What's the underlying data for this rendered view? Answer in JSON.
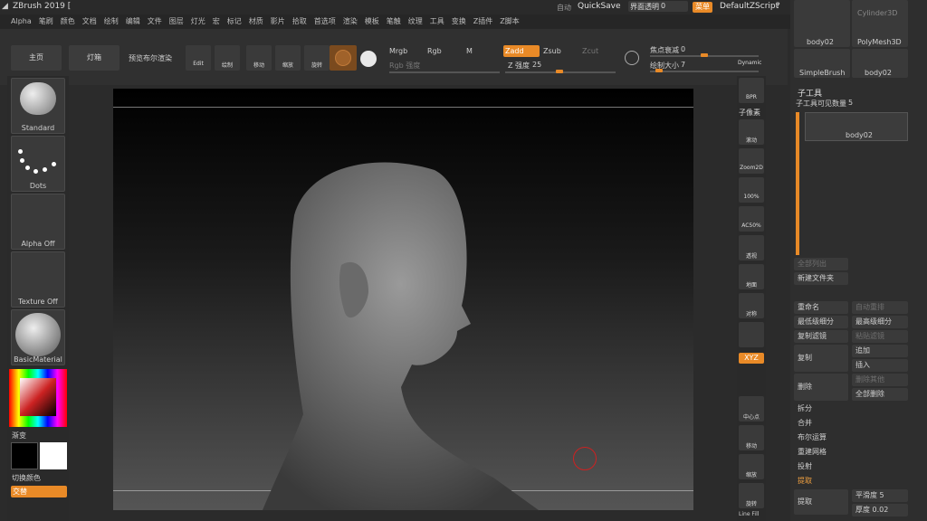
{
  "titlebar": {
    "app_title": "ZBrush 2019 [",
    "auto": "自动",
    "quicksave": "QuickSave",
    "interface_transparency": "界面透明",
    "interface_transparency_value": "0",
    "menu_button": "菜单",
    "default_zscript": "DefaultZScript"
  },
  "menubar": [
    "Alpha",
    "笔刷",
    "颜色",
    "文档",
    "绘制",
    "编辑",
    "文件",
    "图层",
    "灯光",
    "宏",
    "标记",
    "材质",
    "影片",
    "拾取",
    "首选项",
    "渲染",
    "模板",
    "笔触",
    "纹理",
    "工具",
    "变换",
    "Z插件",
    "Z脚本"
  ],
  "shelf": {
    "home": "主页",
    "lightbox": "灯箱",
    "bpr_preview": "预览布尔渲染",
    "edit": "Edit",
    "draw": "绘制",
    "move": "移动",
    "scale": "缩放",
    "rotate": "旋转",
    "mrgb": "Mrgb",
    "rgb": "Rgb",
    "m": "M",
    "zadd": "Zadd",
    "zsub": "Zsub",
    "zcut": "Zcut",
    "rgb_intensity": "Rgb 强度",
    "z_intensity": "Z 强度",
    "z_intensity_value": "25",
    "focal_shift": "焦点衰减",
    "focal_shift_value": "0",
    "draw_size": "绘制大小",
    "draw_size_value": "7",
    "dynamic": "Dynamic"
  },
  "left": {
    "standard": "Standard",
    "dots": "Dots",
    "alpha_off": "Alpha Off",
    "texture_off": "Texture Off",
    "basic_material": "BasicMaterial",
    "gradient": "渐变",
    "switch_color": "切换颜色",
    "alternate": "交替"
  },
  "right_strip": [
    "BPR",
    "子像素",
    "滚动",
    "Zoom2D",
    "100%",
    "AC50%",
    "透视",
    "地面",
    "对称",
    "",
    "XYZ",
    "",
    "",
    "中心点",
    "移动",
    "缩放",
    "旋转",
    "Line Fill"
  ],
  "right_panel": {
    "tool_thumbs": [
      "body02",
      "PolyMesh3D",
      "SimpleBrush",
      "body02"
    ],
    "cylinder": "Cylinder3D",
    "subtool": "子工具",
    "visible_count": "子工具可见数量",
    "visible_count_value": "5",
    "subtool_item": "body02",
    "list_all": "全部列出",
    "new_folder": "新建文件夹",
    "rename": "重命名",
    "auto_reorder": "自动重排",
    "lowest_subdiv": "最低级细分",
    "highest_subdiv": "最高级细分",
    "copy_filter": "复制滤镜",
    "paste_filter": "粘贴滤镜",
    "duplicate": "复制",
    "append": "追加",
    "insert": "插入",
    "delete": "删除",
    "delete_other": "删除其他",
    "delete_all": "全部删除",
    "split": "拆分",
    "merge": "合并",
    "boolean": "布尔运算",
    "remesh": "重建网格",
    "project": "投射",
    "extract": "提取",
    "extract_btn": "提取",
    "smooth": "平滑度",
    "smooth_value": "5",
    "thickness": "厚度",
    "thickness_value": "0.02"
  }
}
